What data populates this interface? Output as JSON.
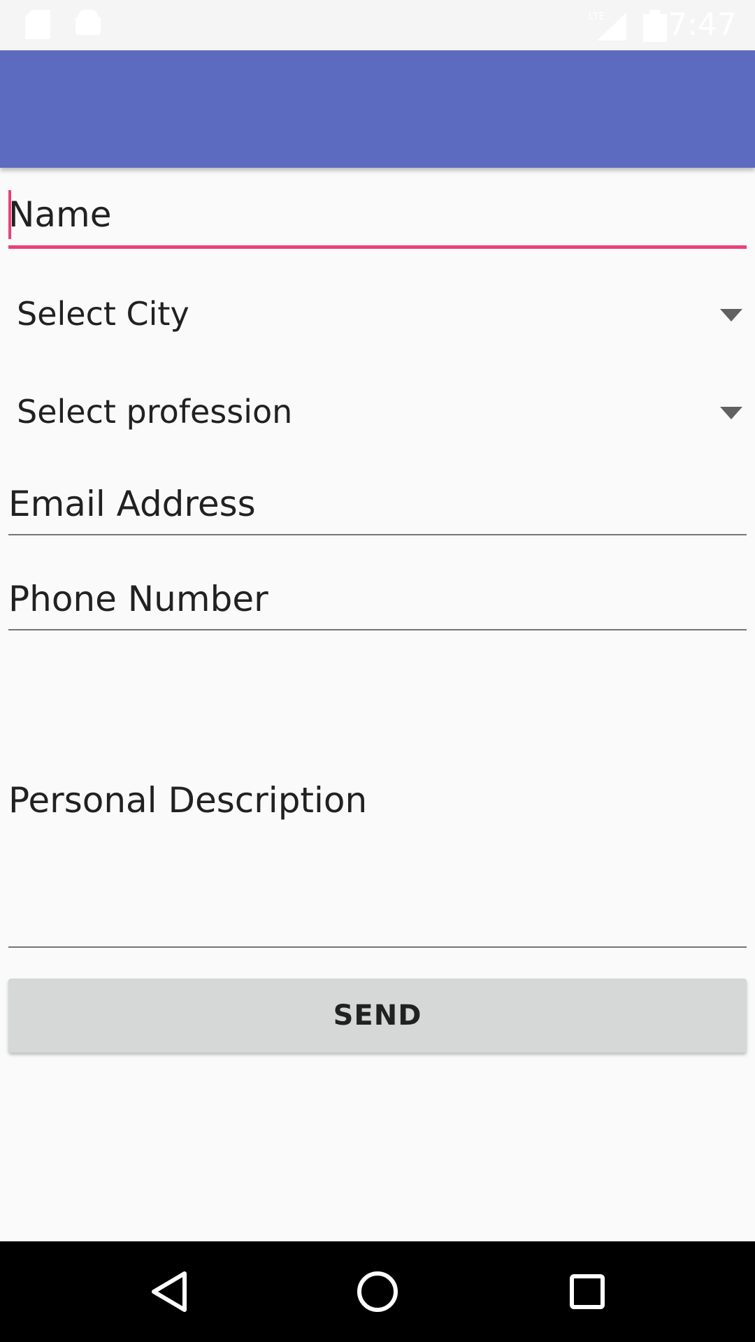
{
  "status_bar": {
    "time": "7:47",
    "icons": [
      "sd-card-icon",
      "android-icon",
      "lte-signal-icon",
      "battery-icon"
    ]
  },
  "form": {
    "name_hint": "Name",
    "city_spinner": "Select City",
    "profession_spinner": "Select profession",
    "email_hint": "Email Address",
    "phone_hint": "Phone Number",
    "description_hint": "Personal Description",
    "send_label": "SEND"
  },
  "nav_bar": {
    "buttons": [
      "back-icon",
      "home-icon",
      "recents-icon"
    ]
  },
  "colors": {
    "app_bar": "#5c6bc0",
    "accent": "#ec407a",
    "button": "#d6d7d7",
    "background": "#fafafa"
  }
}
